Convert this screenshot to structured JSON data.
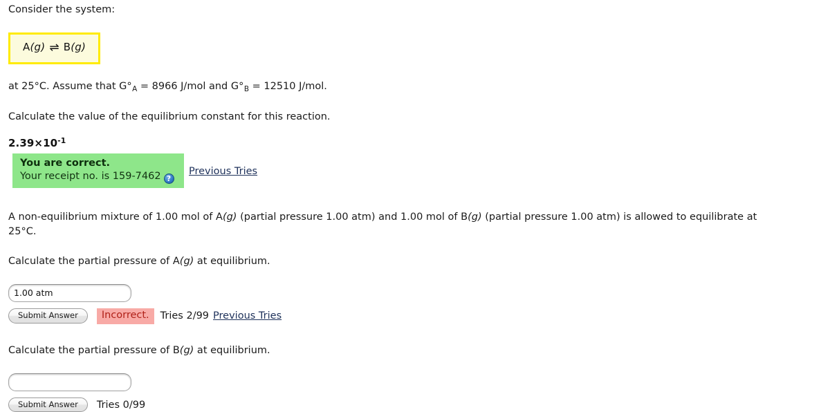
{
  "intro": {
    "prompt": "Consider the system:"
  },
  "reaction": {
    "reactant": "A",
    "reactant_state": "(g)",
    "arrow": "⇌",
    "product": "B",
    "product_state": "(g)",
    "border_color": "#ffeb00",
    "fill_color": "#fcfbdd"
  },
  "conditions": {
    "prefix": "at 25°C. Assume that G°",
    "sub_a": "A",
    "value_a": " = 8966 J/mol and G°",
    "sub_b": "B",
    "value_b": " = 12510 J/mol."
  },
  "question1": {
    "text": "Calculate the value of the equilibrium constant for this reaction.",
    "previous_answer_mantissa": "2.39×10",
    "previous_answer_exponent": "-1",
    "feedback": {
      "title": "You are correct.",
      "receipt": "Your receipt no. is 159-7462",
      "help_icon": "question-mark-icon",
      "background_color": "#8ee68a"
    },
    "previous_tries_link": "Previous Tries"
  },
  "scenario": {
    "line1_part1": "A non-equilibrium mixture of 1.00 mol of A",
    "line1_state1": "(g)",
    "line1_part2": " (partial pressure 1.00 atm) and 1.00 mol of B",
    "line1_state2": "(g)",
    "line1_part3": " (partial pressure 1.00 atm) is allowed to equilibrate at",
    "line2": "25°C."
  },
  "question2": {
    "prompt_part1": "Calculate the partial pressure of A",
    "prompt_state": "(g)",
    "prompt_part2": " at equilibrium.",
    "input_value": "1.00 atm",
    "input_placeholder": "",
    "submit_label": "Submit Answer",
    "status_badge": "Incorrect.",
    "status_color": "#f8aaa6",
    "tries": "Tries 2/99",
    "previous_tries_link": "Previous Tries"
  },
  "question3": {
    "prompt_part1": "Calculate the partial pressure of B",
    "prompt_state": "(g)",
    "prompt_part2": " at equilibrium.",
    "input_value": "",
    "input_placeholder": "",
    "submit_label": "Submit Answer",
    "tries": "Tries 0/99"
  }
}
